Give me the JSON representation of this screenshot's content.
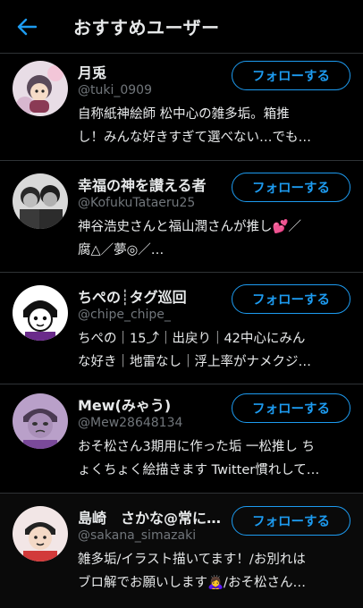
{
  "header": {
    "title": "おすすめユーザー"
  },
  "users": [
    {
      "name": "月兎",
      "handle": "@tuki_0909",
      "bio": [
        "自称紙神絵師 松中心の雑多垢。箱推",
        "し！みんな好きすぎて選べない…でも…"
      ],
      "follow_label": "フォローする"
    },
    {
      "name": "幸福の神を讃える者",
      "handle": "@KofukuTataeru25",
      "bio": [
        "神谷浩史さんと福山潤さんが推し💕／",
        "腐△／夢◎／…"
      ],
      "follow_label": "フォローする"
    },
    {
      "name": "ちぺの┊タグ巡回",
      "handle": "@chipe_chipe_",
      "bio": [
        "ちぺの｜15⤴｜出戻り｜42中心にみん",
        "な好き｜地雷なし｜浮上率がナメクジ…"
      ],
      "follow_label": "フォローする"
    },
    {
      "name": "Mew(みゃう)",
      "handle": "@Mew28648134",
      "bio": [
        "おそ松さん3期用に作った垢 一松推し ち",
        "ょくちょく絵描きます Twitter慣れして…"
      ],
      "follow_label": "フォローする"
    },
    {
      "name": "島崎　さかな@常に…",
      "handle": "@sakana_simazaki",
      "bio": [
        "雑多垢/イラスト描いてます！/お別れは",
        "ブロ解でお願いします🙇‍♀️/おそ松さん…"
      ],
      "follow_label": "フォローする"
    }
  ],
  "colors": {
    "background": "#000000",
    "accent": "#1d9bf0",
    "text": "#e7e9ea",
    "muted": "#71767b",
    "divider": "#2f3336"
  },
  "icons": {
    "back": "arrow-left-icon"
  }
}
